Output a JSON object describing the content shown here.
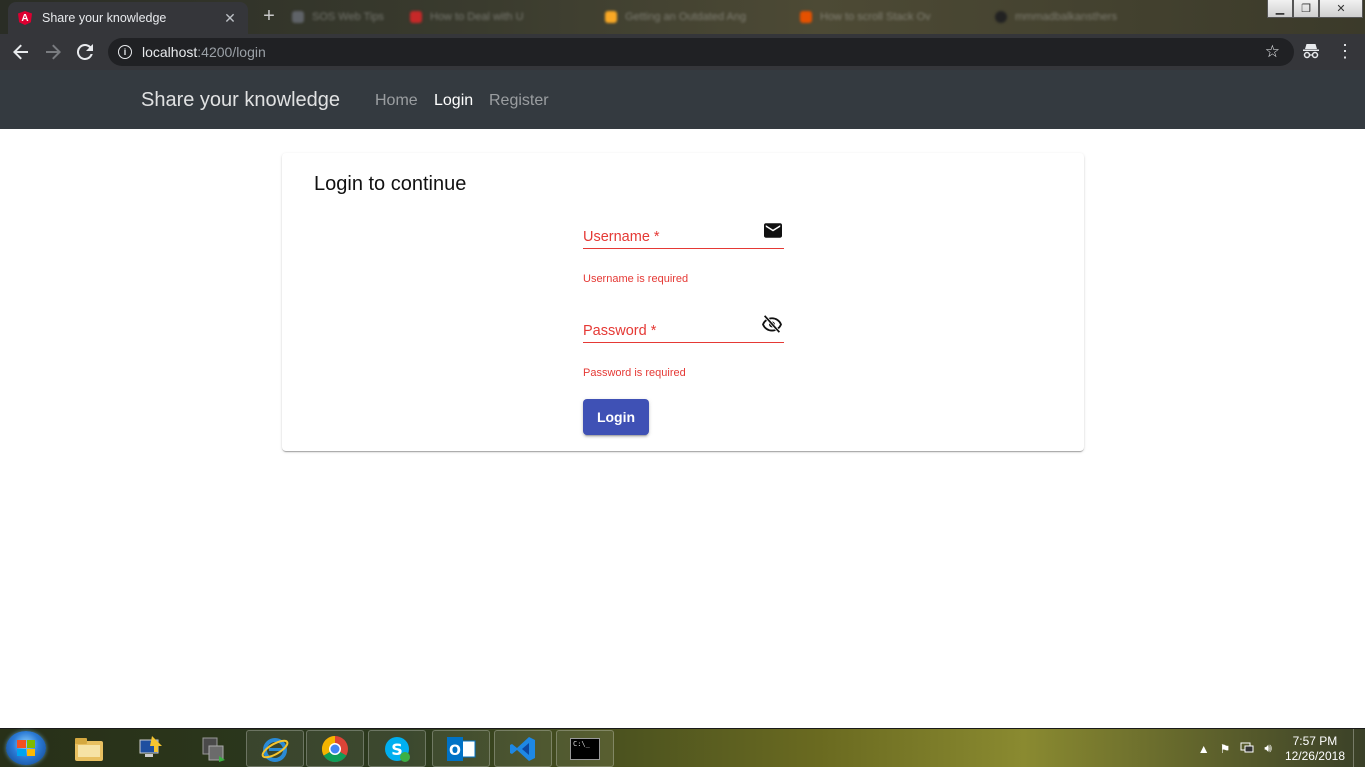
{
  "browser": {
    "active_tab": {
      "title": "Share your knowledge",
      "favicon": "angular-icon",
      "close": "✕"
    },
    "new_tab_label": "+",
    "background_tabs": [
      {
        "title": "SOS Web Tips",
        "icon_color": "#5f6368"
      },
      {
        "title": "How to Deal with U",
        "icon_color": "#c62828"
      },
      {
        "title": "Getting an Outdated Ang",
        "icon_color": "#f9a825"
      },
      {
        "title": "How to scroll Stack Ov",
        "icon_color": "#e65100"
      },
      {
        "title": "mmmadbalkansthers",
        "icon_color": "#222222"
      }
    ],
    "window_controls": {
      "minimize": "▁",
      "maximize": "❐",
      "close": "✕"
    },
    "address": {
      "host": "localhost",
      "rest": ":4200/login"
    }
  },
  "navbar": {
    "brand": "Share your knowledge",
    "links": [
      {
        "label": "Home",
        "active": false
      },
      {
        "label": "Login",
        "active": true
      },
      {
        "label": "Register",
        "active": false
      }
    ]
  },
  "login_card": {
    "title": "Login to continue",
    "username": {
      "label": "Username *",
      "error": "Username is required",
      "icon": "mail-icon"
    },
    "password": {
      "label": "Password *",
      "error": "Password is required",
      "icon": "visibility-off-icon"
    },
    "submit_label": "Login"
  },
  "taskbar": {
    "apps": [
      "windows-explorer",
      "remote-desktop",
      "network-manager",
      "internet-explorer",
      "google-chrome",
      "skype",
      "outlook",
      "visual-studio-code",
      "command-prompt"
    ],
    "cmd_label": "C:\\_",
    "clock_time": "7:57 PM",
    "clock_date": "12/26/2018"
  },
  "colors": {
    "navbar_bg": "#343a40",
    "error": "#e53935",
    "primary": "#3f51b5"
  }
}
